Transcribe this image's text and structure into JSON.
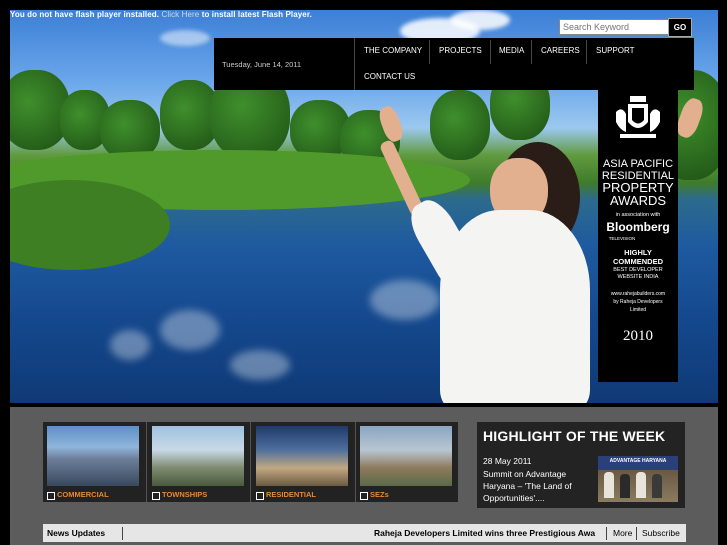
{
  "header": {
    "flash_notice": "You do not have flash player installed.",
    "flash_link": "Click Here",
    "flash_notice_tail": "to install latest Flash Player.",
    "search_placeholder": "Search Keyword",
    "search_button": "GO"
  },
  "nav": {
    "date": "Tuesday, June 14, 2011",
    "items": [
      {
        "label": "THE COMPANY"
      },
      {
        "label": "PROJECTS"
      },
      {
        "label": "MEDIA"
      },
      {
        "label": "CAREERS"
      },
      {
        "label": "SUPPORT"
      },
      {
        "label": "CONTACT US"
      }
    ]
  },
  "award": {
    "line1": "ASIA PACIFIC",
    "line2": "RESIDENTIAL",
    "line3": "PROPERTY",
    "line4": "AWARDS",
    "assoc": "in association with",
    "brand": "Bloomberg",
    "brand_sub": "TELEVISION",
    "commend1": "HIGHLY",
    "commend2": "COMMENDED",
    "best1": "BEST DEVELOPER",
    "best2": "WEBSITE INDIA",
    "site": "www.rahejabuilders.com",
    "by": "by Raheja Developers",
    "ltd": "Limited",
    "year": "2010"
  },
  "projects": [
    {
      "label": "COMMERCIAL"
    },
    {
      "label": "TOWNSHIPS"
    },
    {
      "label": "RESIDENTIAL"
    },
    {
      "label": "SEZs"
    }
  ],
  "highlight": {
    "title": "HIGHLIGHT OF THE WEEK",
    "date": "28 May 2011",
    "text": "Summit on Advantage Haryana – 'The Land of Opportunities'....",
    "image_banner": "ADVANTAGE HARYANA"
  },
  "news": {
    "title": "News Updates",
    "ticker": "Raheja Developers Limited wins three Prestigious Awa",
    "more": "More",
    "subscribe": "Subscribe"
  },
  "colors": {
    "accent": "#e38a35",
    "background": "#000000",
    "panel": "#232323",
    "bottom_band": "#5c5c5c"
  }
}
